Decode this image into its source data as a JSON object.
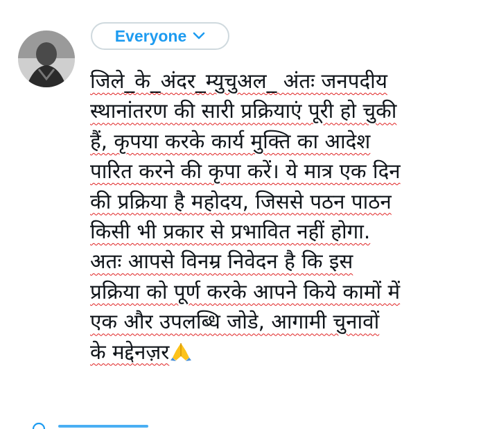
{
  "composer": {
    "avatar_icon": "profile-photo-avatar",
    "audience_label": "Everyone",
    "audience_icon": "chevron-down-icon",
    "accent_color": "#1d9bf0",
    "spellcheck_color": "#e02020",
    "body_lines": [
      "जिले_के_अंदर_म्युचुअल_ अंतः जनपदीय",
      "स्थानांतरण की सारी प्रक्रियाएं पूरी हो चुकी",
      "हैं, कृपया करके कार्य मुक्ति का आदेश",
      "पारित करने की कृपा करें। ये मात्र एक दिन",
      "की प्रक्रिया है महोदय, जिससे पठन पाठन",
      "किसी भी प्रकार से प्रभावित नहीं होगा.",
      "अतः आपसे विनम्र निवेदन है कि इस",
      "प्रक्रिया को पूर्ण करके आपने किये कामों में",
      "एक और उपलब्धि जोडे, आगामी चुनावों",
      "के मद्देनज़र"
    ],
    "body_emoji": "folded-hands-emoji",
    "bottom_icon": "globe-icon"
  }
}
